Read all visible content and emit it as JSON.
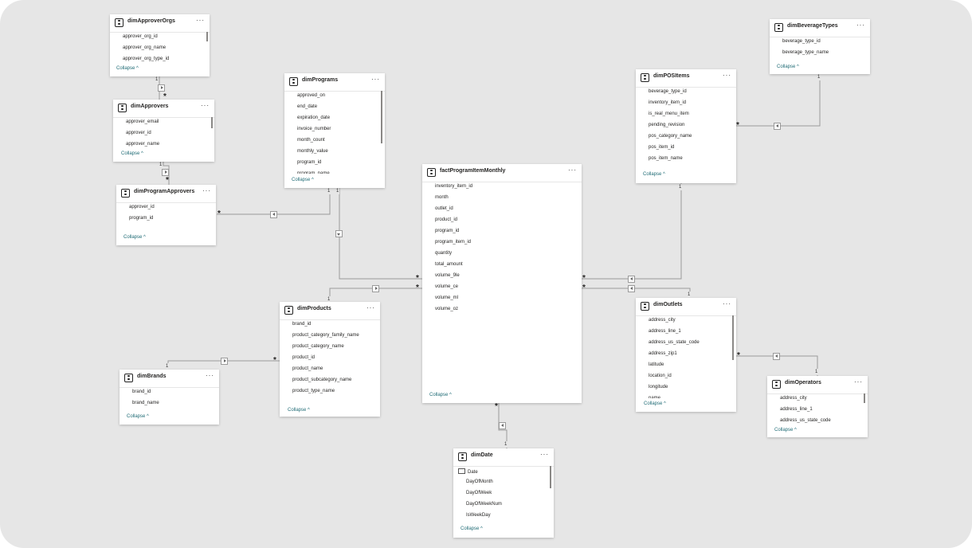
{
  "diagram": {
    "collapse_label": "Collapse ^",
    "more_label": "···",
    "tables": {
      "dimApproverOrgs": {
        "title": "dimApproverOrgs",
        "fields": [
          "approver_org_id",
          "approver_org_name",
          "approver_org_type_id"
        ]
      },
      "dimApprovers": {
        "title": "dimApprovers",
        "fields": [
          "approver_email",
          "approver_id",
          "approver_name"
        ]
      },
      "dimProgramApprovers": {
        "title": "dimProgramApprovers",
        "fields": [
          "approver_id",
          "program_id"
        ]
      },
      "dimPrograms": {
        "title": "dimPrograms",
        "fields": [
          "approved_on",
          "end_date",
          "expiration_date",
          "invoice_number",
          "month_count",
          "monthly_value",
          "program_id",
          "program_name"
        ]
      },
      "factProgramItemMonthly": {
        "title": "factProgramItemMonthly",
        "fields": [
          "inventory_item_id",
          "month",
          "outlet_id",
          "product_id",
          "program_id",
          "program_item_id",
          "quantity",
          "total_amount",
          "volume_9le",
          "volume_ce",
          "volume_ml",
          "volume_oz"
        ]
      },
      "dimPOSItems": {
        "title": "dimPOSItems",
        "fields": [
          "beverage_type_id",
          "inventory_item_id",
          "is_real_menu_item",
          "pending_revision",
          "pos_category_name",
          "pos_item_id",
          "pos_item_name"
        ]
      },
      "dimBeverageTypes": {
        "title": "dimBeverageTypes",
        "fields": [
          "beverage_type_id",
          "beverage_type_name"
        ]
      },
      "dimProducts": {
        "title": "dimProducts",
        "fields": [
          "brand_id",
          "product_category_family_name",
          "product_category_name",
          "product_id",
          "product_name",
          "product_subcategory_name",
          "product_type_name"
        ]
      },
      "dimBrands": {
        "title": "dimBrands",
        "fields": [
          "brand_id",
          "brand_name"
        ]
      },
      "dimOutlets": {
        "title": "dimOutlets",
        "fields": [
          "address_city",
          "address_line_1",
          "address_us_state_code",
          "address_zip1",
          "latitude",
          "location_id",
          "longitude",
          "name"
        ]
      },
      "dimOperators": {
        "title": "dimOperators",
        "fields": [
          "address_city",
          "address_line_1",
          "address_us_state_code"
        ]
      },
      "dimDate": {
        "title": "dimDate",
        "fields": [
          "Date",
          "DayOfMonth",
          "DayOfWeek",
          "DayOfWeekNum",
          "IsWeekDay"
        ]
      }
    },
    "relationships": [
      {
        "from": "dimApproverOrgs",
        "to": "dimApprovers",
        "from_cardinality": "1",
        "to_cardinality": "*"
      },
      {
        "from": "dimApprovers",
        "to": "dimProgramApprovers",
        "from_cardinality": "1",
        "to_cardinality": "*"
      },
      {
        "from": "dimPrograms",
        "to": "dimProgramApprovers",
        "from_cardinality": "1",
        "to_cardinality": "*"
      },
      {
        "from": "dimPrograms",
        "to": "factProgramItemMonthly",
        "from_cardinality": "1",
        "to_cardinality": "*"
      },
      {
        "from": "dimProducts",
        "to": "factProgramItemMonthly",
        "from_cardinality": "1",
        "to_cardinality": "*"
      },
      {
        "from": "dimBrands",
        "to": "dimProducts",
        "from_cardinality": "1",
        "to_cardinality": "*"
      },
      {
        "from": "dimBeverageTypes",
        "to": "dimPOSItems",
        "from_cardinality": "1",
        "to_cardinality": "*"
      },
      {
        "from": "dimPOSItems",
        "to": "factProgramItemMonthly",
        "from_cardinality": "1",
        "to_cardinality": "*"
      },
      {
        "from": "dimOutlets",
        "to": "factProgramItemMonthly",
        "from_cardinality": "1",
        "to_cardinality": "*"
      },
      {
        "from": "dimOperators",
        "to": "dimOutlets",
        "from_cardinality": "1",
        "to_cardinality": "*"
      },
      {
        "from": "dimDate",
        "to": "factProgramItemMonthly",
        "from_cardinality": "1",
        "to_cardinality": "*"
      }
    ]
  }
}
